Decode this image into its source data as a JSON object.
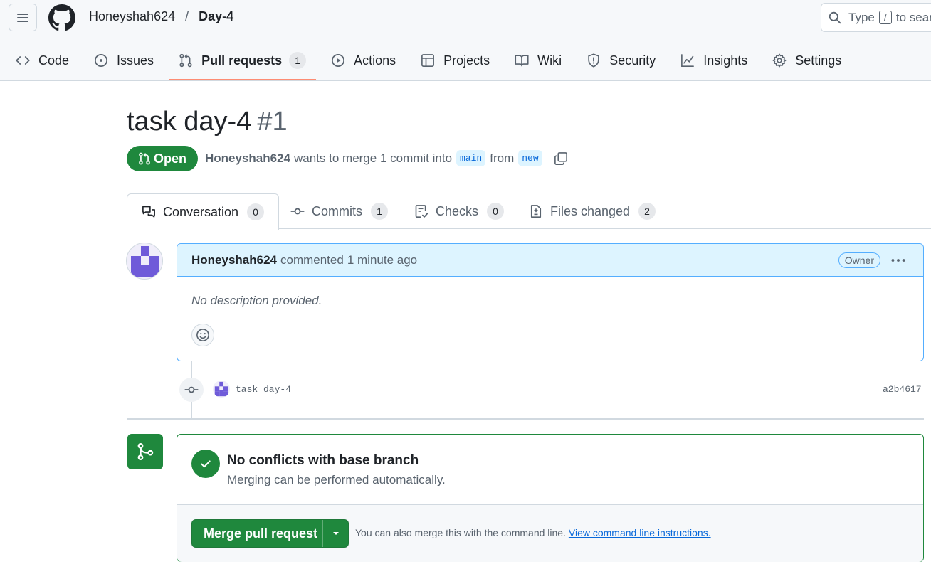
{
  "header": {
    "owner": "Honeyshah624",
    "separator": "/",
    "repo": "Day-4",
    "search_prefix": "Type",
    "search_key": "/",
    "search_suffix": "to search"
  },
  "repo_nav": [
    {
      "label": "Code",
      "icon": "code-icon"
    },
    {
      "label": "Issues",
      "icon": "issue-opened-icon"
    },
    {
      "label": "Pull requests",
      "icon": "git-pull-request-icon",
      "count": "1",
      "active": true
    },
    {
      "label": "Actions",
      "icon": "play-icon"
    },
    {
      "label": "Projects",
      "icon": "table-icon"
    },
    {
      "label": "Wiki",
      "icon": "book-icon"
    },
    {
      "label": "Security",
      "icon": "shield-icon"
    },
    {
      "label": "Insights",
      "icon": "graph-icon"
    },
    {
      "label": "Settings",
      "icon": "gear-icon"
    }
  ],
  "pr": {
    "title": "task day-4",
    "number": "#1",
    "state": "Open",
    "author": "Honeyshah624",
    "meta_text": "wants to merge 1 commit into",
    "base_branch": "main",
    "from_text": "from",
    "head_branch": "new"
  },
  "pr_tabs": [
    {
      "label": "Conversation",
      "count": "0",
      "icon": "comment-discussion-icon"
    },
    {
      "label": "Commits",
      "count": "1",
      "icon": "git-commit-icon"
    },
    {
      "label": "Checks",
      "count": "0",
      "icon": "checklist-icon"
    },
    {
      "label": "Files changed",
      "count": "2",
      "icon": "file-diff-icon"
    }
  ],
  "comment": {
    "author": "Honeyshah624",
    "action": "commented",
    "time": "1 minute ago",
    "role": "Owner",
    "body": "No description provided."
  },
  "commit": {
    "message": "task day-4",
    "sha": "a2b4617"
  },
  "mergebox": {
    "title": "No conflicts with base branch",
    "subtitle": "Merging can be performed automatically.",
    "button": "Merge pull request",
    "hint": "You can also merge this with the command line.",
    "hint_link": "View command line instructions."
  },
  "colors": {
    "primary_green": "#1f883d",
    "link_blue": "#0969da",
    "tab_underline": "#fd8c73",
    "avatar_purple": "#6f5bd9"
  }
}
